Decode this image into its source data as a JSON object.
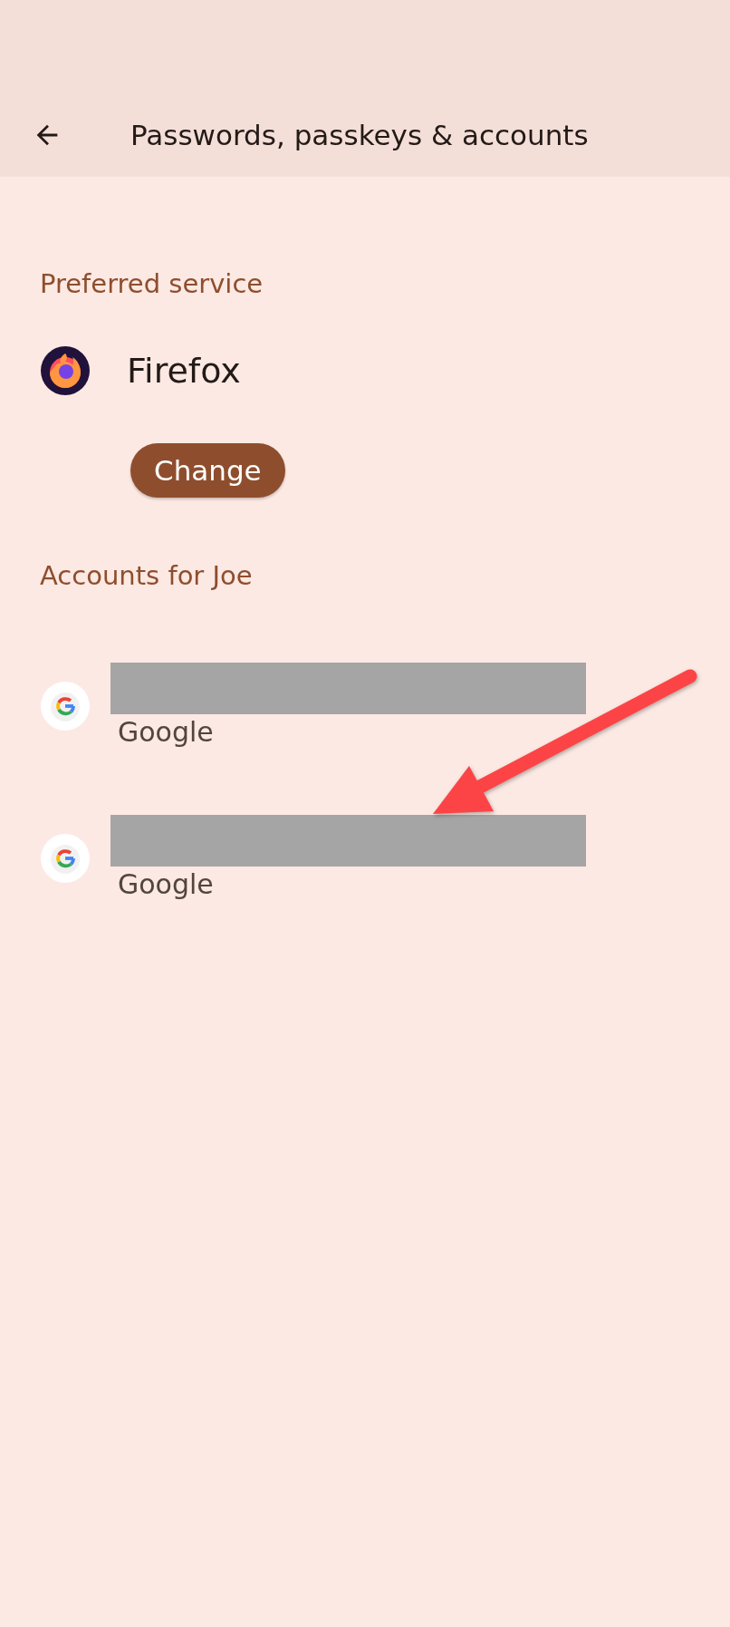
{
  "app_bar": {
    "title": "Passwords, passkeys & accounts"
  },
  "preferred_service": {
    "heading": "Preferred service",
    "name": "Firefox",
    "button": "Change"
  },
  "accounts": {
    "heading": "Accounts for Joe",
    "items": [
      {
        "provider": "Google",
        "redacted": true
      },
      {
        "provider": "Google",
        "redacted": true
      }
    ]
  }
}
